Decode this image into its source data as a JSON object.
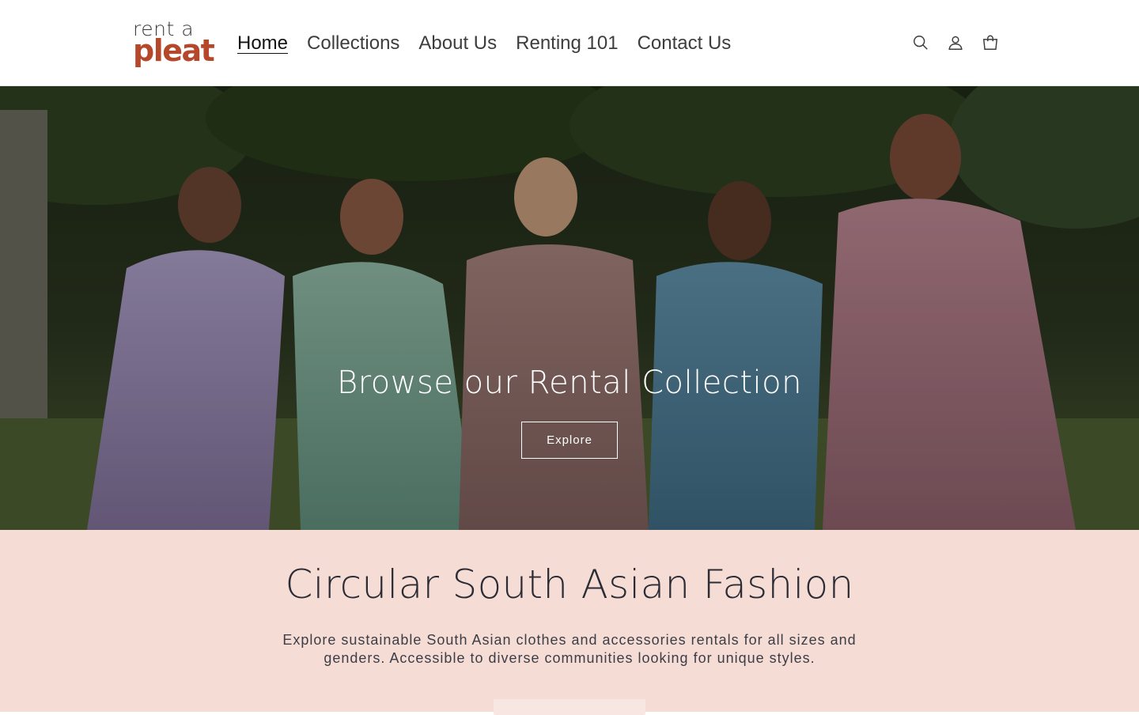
{
  "logo": {
    "top": "rent a",
    "bottom": "pleat"
  },
  "nav": {
    "items": [
      {
        "label": "Home",
        "active": true
      },
      {
        "label": "Collections"
      },
      {
        "label": "About Us"
      },
      {
        "label": "Renting 101"
      },
      {
        "label": "Contact Us"
      }
    ]
  },
  "header_icons": [
    "search-icon",
    "account-icon",
    "cart-icon"
  ],
  "hero": {
    "title": "Browse our Rental Collection",
    "button_label": "Explore"
  },
  "intro": {
    "title": "Circular South Asian Fashion",
    "text": "Explore sustainable South Asian clothes and accessories rentals for all sizes and genders. Accessible to diverse communities looking for unique styles."
  },
  "colors": {
    "brand": "#b5482b",
    "section_bg": "#f5ddd6",
    "text_dark": "#2c2c34"
  }
}
